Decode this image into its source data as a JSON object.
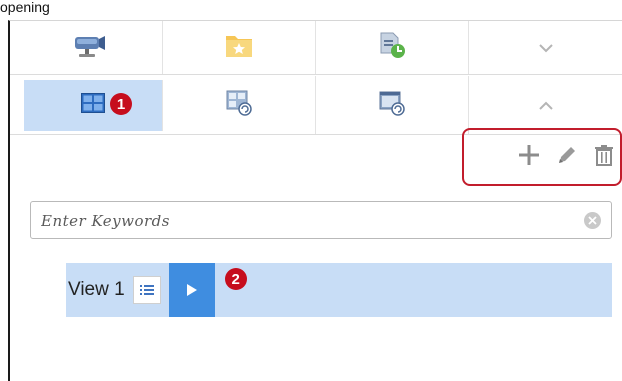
{
  "caption": "opening",
  "toolbar_row1": {
    "items": [
      {
        "icon": "camera-icon"
      },
      {
        "icon": "favorites-folder-icon"
      },
      {
        "icon": "scheduled-document-icon"
      },
      {
        "icon": "chevron-down-icon",
        "symbol": "⌄"
      }
    ]
  },
  "toolbar_row2": {
    "items": [
      {
        "icon": "layout-grid-icon",
        "selected": true
      },
      {
        "icon": "grid-refresh-icon"
      },
      {
        "icon": "window-refresh-icon"
      },
      {
        "icon": "chevron-up-icon",
        "symbol": "⌃"
      }
    ]
  },
  "annotations": [
    "1",
    "2"
  ],
  "actions": {
    "add_icon": "plus-icon",
    "edit_icon": "pencil-icon",
    "delete_icon": "trash-icon"
  },
  "search": {
    "placeholder": "Enter Keywords",
    "value": "",
    "clear_icon": "clear-circle-icon"
  },
  "views": [
    {
      "label": "View 1",
      "selected": true
    }
  ],
  "colors": {
    "selected_bg": "#c8ddf6",
    "play_button": "#3f8de0",
    "annotation_red": "#c60d1d",
    "highlight_border": "#c21d2c"
  }
}
